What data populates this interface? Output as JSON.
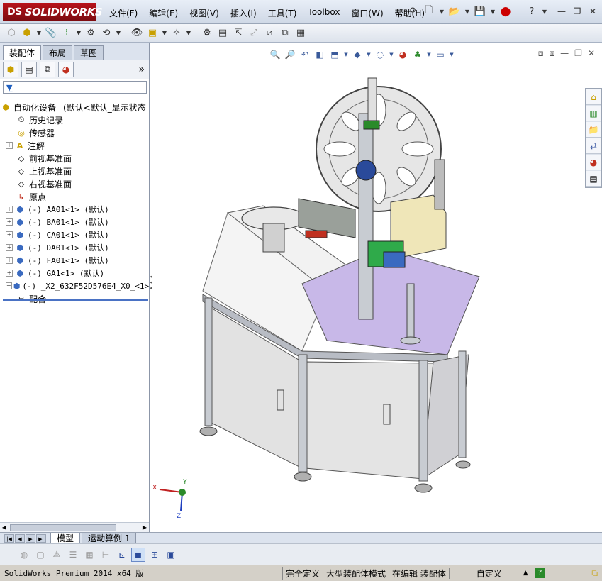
{
  "app": {
    "logo_prefix": "DS",
    "logo_name": "SOLIDWORKS"
  },
  "menu": [
    {
      "label": "文件(F)"
    },
    {
      "label": "编辑(E)"
    },
    {
      "label": "视图(V)"
    },
    {
      "label": "插入(I)"
    },
    {
      "label": "工具(T)"
    },
    {
      "label": "Toolbox"
    },
    {
      "label": "窗口(W)"
    },
    {
      "label": "帮助(H)"
    }
  ],
  "left_tabs": [
    {
      "label": "装配体"
    },
    {
      "label": "布局"
    },
    {
      "label": "草图"
    }
  ],
  "tree": {
    "root_label": "自动化设备",
    "root_config": "(默认<默认_显示状态",
    "items": [
      {
        "label": "历史记录"
      },
      {
        "label": "传感器"
      },
      {
        "label": "注解"
      },
      {
        "label": "前视基准面"
      },
      {
        "label": "上视基准面"
      },
      {
        "label": "右视基准面"
      },
      {
        "label": "原点"
      }
    ],
    "components": [
      {
        "label": "(-) AA01<1> (默认)"
      },
      {
        "label": "(-) BA01<1> (默认)"
      },
      {
        "label": "(-) CA01<1> (默认)"
      },
      {
        "label": "(-) DA01<1> (默认)"
      },
      {
        "label": "(-) FA01<1> (默认)"
      },
      {
        "label": "(-) GA1<1> (默认)"
      },
      {
        "label": "(-) _X2_632F52D576E4_X0_<1>"
      }
    ],
    "mates_label": "配合"
  },
  "triad": {
    "x": "X",
    "y": "Y",
    "z": "Z"
  },
  "bottom_tabs": [
    {
      "label": "模型"
    },
    {
      "label": "运动算例 1"
    }
  ],
  "status": {
    "product": "SolidWorks Premium 2014 x64 版",
    "defined": "完全定义",
    "mode": "大型装配体模式",
    "editing": "在编辑 装配体",
    "custom": "自定义",
    "custom_arrow": "▲",
    "help": "?"
  },
  "colors": {
    "viewport_bg": "#ffffff",
    "table_purple": "#c8b8e8",
    "frame_silver": "#c8ccd2",
    "panel_gray": "#e2e2e2",
    "accent_blue": "#4a72c4"
  }
}
